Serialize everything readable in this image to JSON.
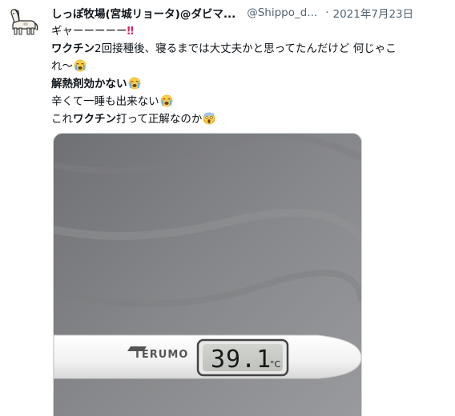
{
  "tweet": {
    "display_name": "しっぽ牧場(宮城リョータ)@ダビマ...",
    "handle": "@Shippo_d...",
    "separator": "·",
    "date": "2021年7月23日",
    "lines": {
      "l1": "ギャーーーーー",
      "l2_bold": "ワクチン",
      "l2_rest": "2回接種後、寝るまでは大丈夫かと思ってたんだけど 何じゃこ",
      "l3": "れ〜",
      "l4": "解熱剤効かない",
      "l5": "辛くて一睡も出来ない",
      "l6_pre": "これ",
      "l6_bold": "ワクチン",
      "l6_post": "打って正解なのか"
    },
    "emoji": {
      "double_exclamation": "‼",
      "crying_face": "loudly-crying-face-icon",
      "scream_face": "face-screaming-in-fear-icon"
    }
  },
  "media": {
    "thermometer_brand": "TERUMO",
    "thermometer_reading": "39.1",
    "thermometer_unit": "°C"
  },
  "colors": {
    "text": "#0f1419",
    "secondary": "#536471",
    "exclamation": "#e0245e",
    "border": "#cfd9de"
  }
}
